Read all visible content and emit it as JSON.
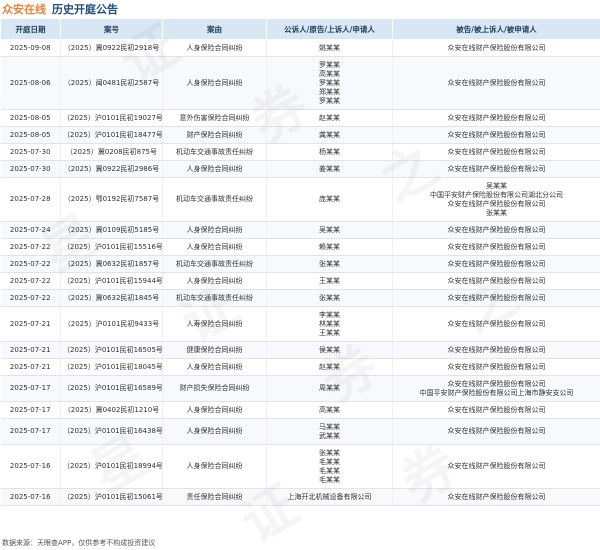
{
  "header": {
    "company": "众安在线",
    "title": "历史开庭公告"
  },
  "table": {
    "columns": [
      "开庭日期",
      "案号",
      "案由",
      "公诉人/原告/上诉人/申请人",
      "被告/被上诉人/被申请人"
    ],
    "rows": [
      {
        "date": "2025-09-08",
        "case_no": "（2025）冀0922民初2918号",
        "cause": "人身保险合同纠纷",
        "plaintiffs": [
          "姚某某"
        ],
        "defendants": [
          "众安在线财产保险股份有限公司"
        ]
      },
      {
        "date": "2025-08-06",
        "case_no": "（2025）闽0481民初2587号",
        "cause": "人身保险合同纠纷",
        "plaintiffs": [
          "罗某某",
          "高某某",
          "罗某某",
          "郑某某",
          "罗某某"
        ],
        "defendants": [
          "众安在线财产保险股份有限公司"
        ]
      },
      {
        "date": "2025-08-05",
        "case_no": "（2025）沪0101民初19027号",
        "cause": "意外伤害保险合同纠纷",
        "plaintiffs": [
          "赵某某"
        ],
        "defendants": [
          "众安在线财产保险股份有限公司"
        ]
      },
      {
        "date": "2025-08-05",
        "case_no": "（2025）沪0101民初18477号",
        "cause": "财产保险合同纠纷",
        "plaintiffs": [
          "龚某某"
        ],
        "defendants": [
          "众安在线财产保险股份有限公司"
        ]
      },
      {
        "date": "2025-07-30",
        "case_no": "（2025）冀0208民初875号",
        "cause": "机动车交通事故责任纠纷",
        "plaintiffs": [
          "杨某某"
        ],
        "defendants": [
          "众安在线财产保险股份有限公司"
        ]
      },
      {
        "date": "2025-07-30",
        "case_no": "（2025）冀0922民初2986号",
        "cause": "人身保险合同纠纷",
        "plaintiffs": [
          "姜某某"
        ],
        "defendants": [
          "众安在线财产保险股份有限公司"
        ]
      },
      {
        "date": "2025-07-28",
        "case_no": "（2025）鄂0192民初7587号",
        "cause": "机动车交通事故责任纠纷",
        "plaintiffs": [
          "庞某某"
        ],
        "defendants": [
          "吴某某",
          "中国平安财产保险股份有限公司湖北分公司",
          "众安在线财产保险股份有限公司",
          "张某某"
        ]
      },
      {
        "date": "2025-07-24",
        "case_no": "（2025）冀0109民初5185号",
        "cause": "人身保险合同纠纷",
        "plaintiffs": [
          "吴某某"
        ],
        "defendants": [
          "众安在线财产保险股份有限公司"
        ]
      },
      {
        "date": "2025-07-22",
        "case_no": "（2025）沪0101民初15516号",
        "cause": "人身保险合同纠纷",
        "plaintiffs": [
          "赖某某"
        ],
        "defendants": [
          "众安在线财产保险股份有限公司"
        ]
      },
      {
        "date": "2025-07-22",
        "case_no": "（2025）冀0632民初1857号",
        "cause": "机动车交通事故责任纠纷",
        "plaintiffs": [
          "张某某"
        ],
        "defendants": [
          "众安在线财产保险股份有限公司"
        ]
      },
      {
        "date": "2025-07-22",
        "case_no": "（2025）沪0101民初15944号",
        "cause": "人身保险合同纠纷",
        "plaintiffs": [
          "王某某"
        ],
        "defendants": [
          "众安在线财产保险股份有限公司"
        ]
      },
      {
        "date": "2025-07-22",
        "case_no": "（2025）冀0632民初1845号",
        "cause": "机动车交通事故责任纠纷",
        "plaintiffs": [
          "张某某"
        ],
        "defendants": [
          "众安在线财产保险股份有限公司"
        ]
      },
      {
        "date": "2025-07-21",
        "case_no": "（2025）沪0101民初9433号",
        "cause": "人寿保险合同纠纷",
        "plaintiffs": [
          "李某某",
          "林某某",
          "王某某"
        ],
        "defendants": [
          "众安在线财产保险股份有限公司"
        ]
      },
      {
        "date": "2025-07-21",
        "case_no": "（2025）沪0101民初16505号",
        "cause": "健康保险合同纠纷",
        "plaintiffs": [
          "侯某某"
        ],
        "defendants": [
          "众安在线财产保险股份有限公司"
        ]
      },
      {
        "date": "2025-07-21",
        "case_no": "（2025）沪0101民初18045号",
        "cause": "人身保险合同纠纷",
        "plaintiffs": [
          "赵某某"
        ],
        "defendants": [
          "众安在线财产保险股份有限公司"
        ]
      },
      {
        "date": "2025-07-17",
        "case_no": "（2025）沪0101民初16589号",
        "cause": "财产损失保险合同纠纷",
        "plaintiffs": [
          "周某某"
        ],
        "defendants": [
          "众安在线财产保险股份有限公司",
          "中国平安财产保险股份有限公司上海市静安支公司"
        ]
      },
      {
        "date": "2025-07-17",
        "case_no": "（2025）冀0402民初1210号",
        "cause": "人身保险合同纠纷",
        "plaintiffs": [
          "高某某"
        ],
        "defendants": [
          "众安在线财产保险股份有限公司"
        ]
      },
      {
        "date": "2025-07-17",
        "case_no": "（2025）沪0101民初16438号",
        "cause": "人身保险合同纠纷",
        "plaintiffs": [
          "马某某",
          "武某某"
        ],
        "defendants": [
          "众安在线财产保险股份有限公司"
        ]
      },
      {
        "date": "2025-07-16",
        "case_no": "（2025）沪0101民初18994号",
        "cause": "人身保险合同纠纷",
        "plaintiffs": [
          "张某某",
          "毛某某",
          "毛某某",
          "毛某某"
        ],
        "defendants": [
          "众安在线财产保险股份有限公司"
        ]
      },
      {
        "date": "2025-07-16",
        "case_no": "（2025）沪0101民初15061号",
        "cause": "责任保险合同纠纷",
        "plaintiffs": [
          "上海开北机械设备有限公司"
        ],
        "defendants": [
          "众安在线财产保险股份有限公司"
        ]
      }
    ]
  },
  "footer": {
    "text": "数据来源：天眼查APP，仅供参考不构成投资建议"
  },
  "watermark": {
    "chars": [
      "证",
      "券",
      "之",
      "星"
    ]
  }
}
